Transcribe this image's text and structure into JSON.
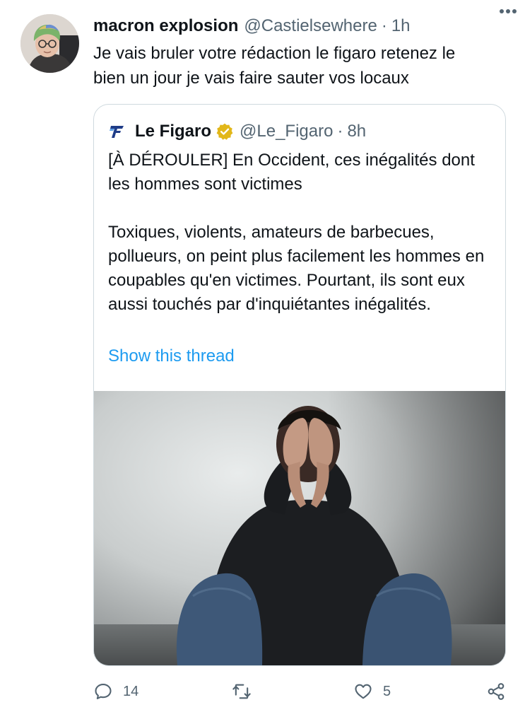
{
  "author": {
    "name": "macron explosion",
    "handle": "@Castielsewhere",
    "separator": "·",
    "time": "1h"
  },
  "tweet": {
    "text": "Je vais bruler votre rédaction le figaro retenez le\nbien un jour je vais faire sauter vos locaux"
  },
  "quoted": {
    "name": "Le Figaro",
    "handle": "@Le_Figaro",
    "separator": "·",
    "time": "8h",
    "paragraph1": "[À DÉROULER] En Occident, ces inégalités dont les hommes sont victimes",
    "paragraph2": "Toxiques, violents, amateurs de barbecues, pollueurs, on peint plus facilement les hommes en coupables qu'en victimes. Pourtant, ils sont eux aussi touchés par d'inquiétantes inégalités.",
    "show_thread": "Show this thread"
  },
  "actions": {
    "replies": "14",
    "retweets": "",
    "likes": "5"
  },
  "colors": {
    "text": "#0f1419",
    "secondary": "#536471",
    "link": "#1d9bf0",
    "border": "#cfd9de",
    "verified": "#e2b719"
  },
  "icons": [
    "more-icon",
    "figaro-logo-icon",
    "verified-badge-icon",
    "reply-icon",
    "retweet-icon",
    "like-icon",
    "share-icon"
  ]
}
